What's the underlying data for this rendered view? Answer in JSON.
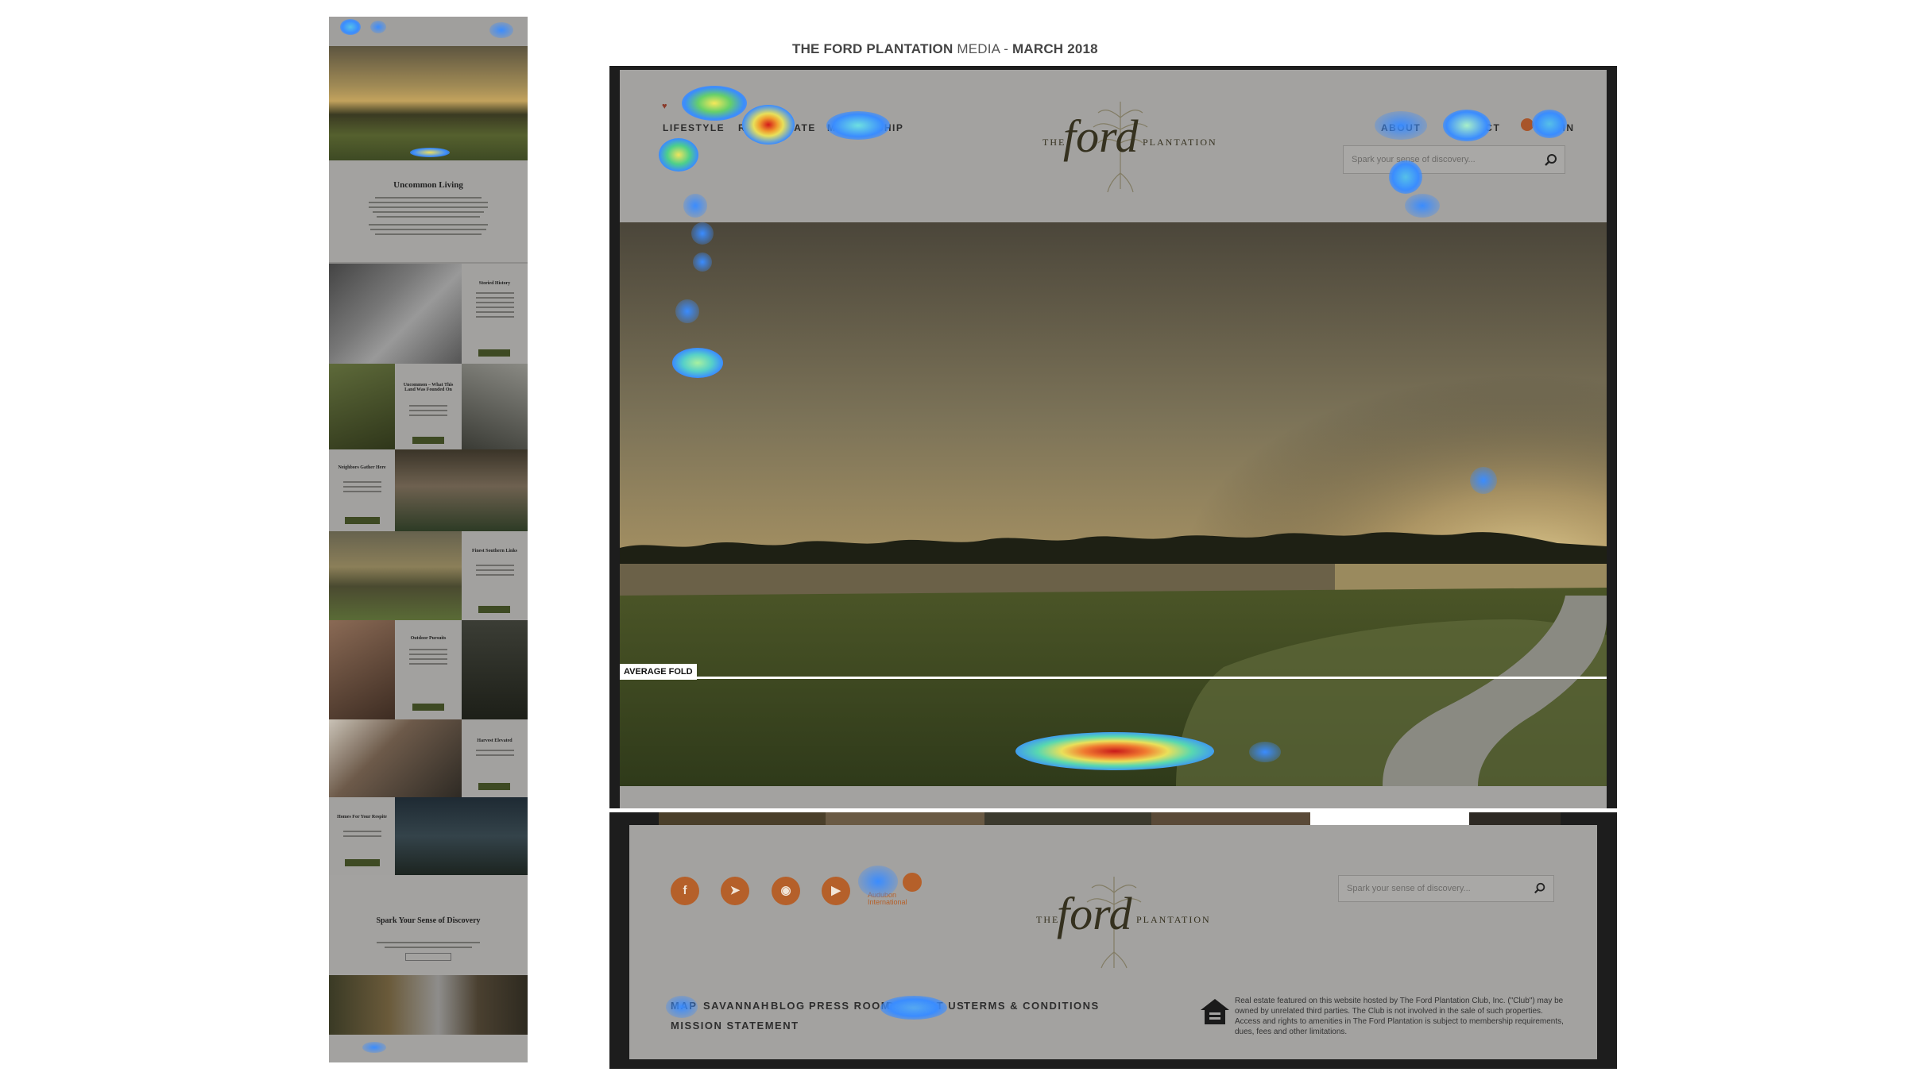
{
  "report": {
    "brand": "THE FORD PLANTATION",
    "media": "MEDIA -",
    "period": "MARCH 2018"
  },
  "thumbnail": {
    "section_titles": [
      "Uncommon Living",
      "Storied History",
      "Uncommon – What This Land Was Founded On",
      "Neighbors Gather Here",
      "Finest Southern Links",
      "Outdoor Pursuits",
      "Harvest Elevated",
      "Homes For Your Respite",
      "Spark Your Sense of Discovery"
    ]
  },
  "site": {
    "logo": {
      "prefix": "THE",
      "script": "ford",
      "suffix": "PLANTATION"
    },
    "nav_left": [
      "LIFESTYLE",
      "REAL ESTATE",
      "MEMBERSHIP"
    ],
    "nav_right": [
      "ABOUT",
      "CONTACT",
      "LOGIN"
    ],
    "search_placeholder": "Spark your sense of discovery..."
  },
  "fold": {
    "label": "AVERAGE FOLD"
  },
  "footer": {
    "social_icons": [
      "facebook-icon",
      "twitter-icon",
      "instagram-icon",
      "youtube-icon"
    ],
    "audubon_label": "Audubon International",
    "search_placeholder": "Spark your sense of discovery...",
    "links_row1": [
      "MAP",
      "SAVANNAH",
      "BLOG",
      "PRESS ROOM",
      "CONTACT US",
      "TERMS & CONDITIONS"
    ],
    "links_row2": [
      "MISSION STATEMENT"
    ],
    "disclaimer": "Real estate featured on this website hosted by The Ford Plantation Club, Inc. (\"Club\") may be owned by unrelated third parties. The Club is not involved in the sale of such properties. Access and rights to amenities in The Ford Plantation is subject to membership requirements, dues, fees and other limitations."
  },
  "colors": {
    "accent_social": "#b5602a",
    "button_green": "#3e4a23",
    "fold_line": "#ffffff",
    "overlay_gray": "#8e8d8b"
  }
}
